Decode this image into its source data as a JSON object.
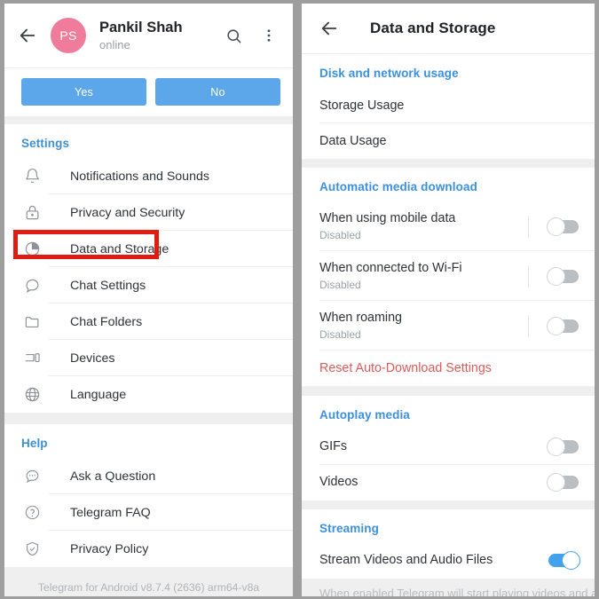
{
  "left_panel": {
    "header": {
      "back_icon": "back-arrow-icon",
      "avatar_initials": "PS",
      "avatar_color": "#ef7c9a",
      "name": "Pankil Shah",
      "status": "online",
      "search_icon": "search-icon",
      "menu_icon": "overflow-menu-icon"
    },
    "prompt_buttons": [
      {
        "label": "Yes"
      },
      {
        "label": "No"
      }
    ],
    "settings_section": {
      "header": "Settings",
      "items": [
        {
          "label": "Notifications and Sounds",
          "icon": "bell-icon"
        },
        {
          "label": "Privacy and Security",
          "icon": "lock-icon"
        },
        {
          "label": "Data and Storage",
          "icon": "pie-chart-icon",
          "highlighted": true
        },
        {
          "label": "Chat Settings",
          "icon": "chat-bubble-icon"
        },
        {
          "label": "Chat Folders",
          "icon": "folder-icon"
        },
        {
          "label": "Devices",
          "icon": "devices-icon"
        },
        {
          "label": "Language",
          "icon": "globe-icon"
        }
      ]
    },
    "help_section": {
      "header": "Help",
      "items": [
        {
          "label": "Ask a Question",
          "icon": "chat-dots-icon"
        },
        {
          "label": "Telegram FAQ",
          "icon": "question-circle-icon"
        },
        {
          "label": "Privacy Policy",
          "icon": "shield-check-icon"
        }
      ]
    },
    "version": "Telegram for Android v8.7.4 (2636) arm64-v8a"
  },
  "right_panel": {
    "header": {
      "back_icon": "back-arrow-icon",
      "title": "Data and Storage"
    },
    "disk_section": {
      "header": "Disk and network usage",
      "items": [
        {
          "label": "Storage Usage",
          "highlighted": true
        },
        {
          "label": "Data Usage",
          "highlighted": false
        }
      ]
    },
    "auto_download_section": {
      "header": "Automatic media download",
      "items": [
        {
          "label": "When using mobile data",
          "sub": "Disabled",
          "toggle": "off"
        },
        {
          "label": "When connected to Wi-Fi",
          "sub": "Disabled",
          "toggle": "off"
        },
        {
          "label": "When roaming",
          "sub": "Disabled",
          "toggle": "off"
        }
      ],
      "reset_label": "Reset Auto-Download Settings"
    },
    "autoplay_section": {
      "header": "Autoplay media",
      "items": [
        {
          "label": "GIFs",
          "toggle": "off"
        },
        {
          "label": "Videos",
          "toggle": "off"
        }
      ]
    },
    "streaming_section": {
      "header": "Streaming",
      "items": [
        {
          "label": "Stream Videos and Audio Files",
          "toggle": "on"
        }
      ],
      "cutoff_text": "When enabled Telegram will start playing videos and audio"
    }
  },
  "colors": {
    "accent_blue": "#3b90e0",
    "button_blue": "#5ba7e9",
    "toggle_on": "#44a1ec",
    "highlight_red": "#e01b12",
    "danger_red": "#dd5a5a",
    "avatar_pink": "#ef7c9a"
  }
}
